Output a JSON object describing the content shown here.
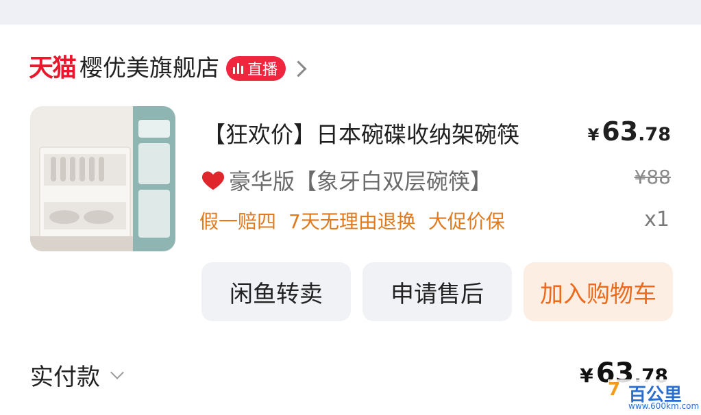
{
  "shop": {
    "platform_logo": "天猫",
    "name": "樱优美旗舰店",
    "live_label": "直播"
  },
  "product": {
    "title": "【狂欢价】日本碗碟收纳架碗筷",
    "price_currency": "¥",
    "price_integer": "63",
    "price_decimal": ".78",
    "variant": "豪华版【象牙白双层碗筷】",
    "original_price": "¥88",
    "tags": [
      "假一赔四",
      "7天无理由退换",
      "大促价保"
    ],
    "quantity": "x1"
  },
  "actions": {
    "resell": "闲鱼转卖",
    "after_sales": "申请售后",
    "add_to_cart": "加入购物车"
  },
  "footer": {
    "paid_label": "实付款",
    "paid_currency": "¥",
    "paid_integer": "63",
    "paid_decimal": ".78"
  },
  "watermark": {
    "logo": "7",
    "text": "百公里",
    "url": "www.600km.com"
  },
  "colors": {
    "tmall_red": "#e8192c",
    "tag_orange": "#e07a1f",
    "cart_orange": "#ec6a1c",
    "live_badge": "#f0263f"
  }
}
